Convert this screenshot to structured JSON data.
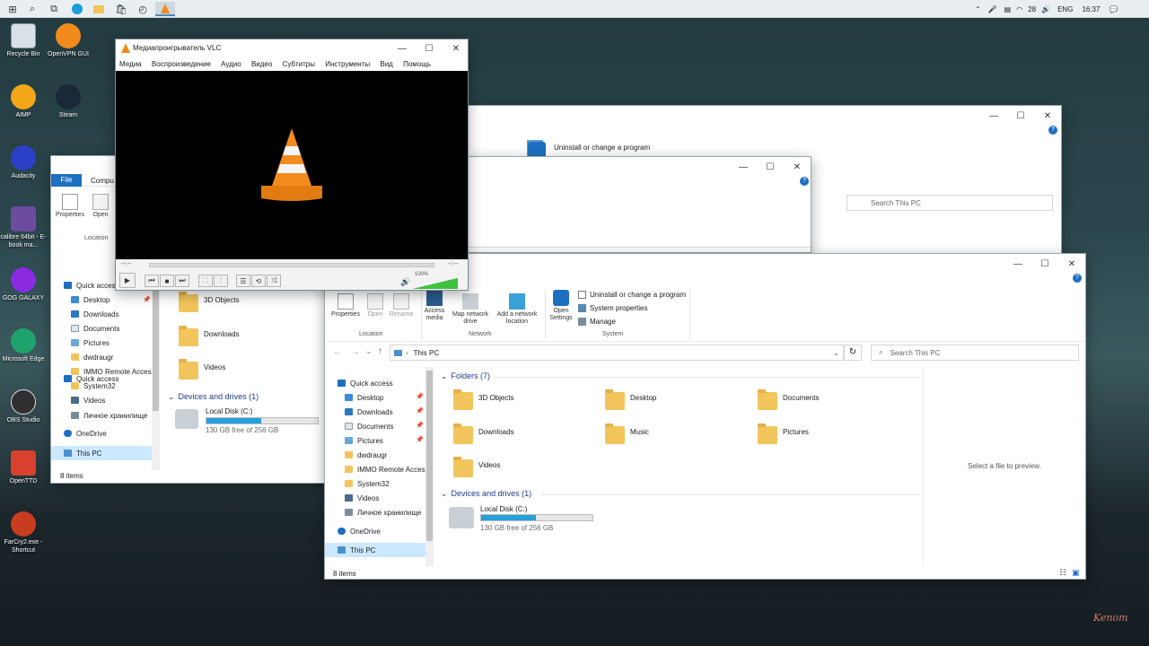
{
  "taskbar": {
    "time": "16:37",
    "lang": "ENG",
    "weather": "28"
  },
  "desktop": {
    "icons": [
      {
        "name": "recycle-bin-icon",
        "label": "Recycle Bin"
      },
      {
        "name": "openvpn-icon",
        "label": "OpenVPN GUI"
      },
      {
        "name": "aimp-icon",
        "label": "AIMP"
      },
      {
        "name": "steam-icon",
        "label": "Steam"
      },
      {
        "name": "audacity-icon",
        "label": "Audacity"
      },
      {
        "name": "calibre-icon",
        "label": "calibre 64bit - E-book ma..."
      },
      {
        "name": "gog-galaxy-icon",
        "label": "GOG GALAXY"
      },
      {
        "name": "microsoft-edge-icon",
        "label": "Microsoft Edge"
      },
      {
        "name": "obs-studio-icon",
        "label": "OBS Studio"
      },
      {
        "name": "openttd-icon",
        "label": "OpenTTD"
      },
      {
        "name": "farcry2-icon",
        "label": "FarCry2.exe - Shortcut"
      }
    ],
    "watermark": "Kenom"
  },
  "vlc": {
    "title": "Медиапроигрыватель VLC",
    "menu": [
      "Медиа",
      "Воспроизведение",
      "Аудио",
      "Видео",
      "Субтитры",
      "Инструменты",
      "Вид",
      "Помощь"
    ],
    "time_left": "--:--",
    "time_right": "--:--",
    "volume": "100%"
  },
  "explorer_bg": {
    "uninstall": "Uninstall or change a program",
    "search_placeholder": "Search This PC"
  },
  "explorer_left": {
    "tab_file": "File",
    "tab_computer": "Compu",
    "properties": "Properties",
    "open": "Open",
    "location": "Location",
    "nav": [
      "Quick access",
      "Desktop",
      "Downloads",
      "Documents",
      "Pictures",
      "dwdraugr",
      "IMMO Remote Acces",
      "System32",
      "Videos",
      "Личное хранилище",
      "OneDrive",
      "This PC"
    ],
    "folders": [
      "3D Objects",
      "Downloads",
      "Videos"
    ],
    "devices_header": "Devices and drives (1)",
    "drive_name": "Local Disk (C:)",
    "drive_free": "130 GB free of 256 GB",
    "drive_fill": 0.49,
    "status": "8 items"
  },
  "explorer_main": {
    "ribbon": {
      "properties": "Properties",
      "open": "Open",
      "rename": "Rename",
      "access_media": "Access media",
      "map_network_drive": "Map network drive",
      "add_network_location": "Add a network location",
      "open_settings": "Open Settings",
      "uninstall": "Uninstall or change a program",
      "system_properties": "System properties",
      "manage": "Manage",
      "group_location": "Location",
      "group_network": "Network",
      "group_system": "System"
    },
    "address": "This PC",
    "search_placeholder": "Search This PC",
    "nav": [
      "Quick access",
      "Desktop",
      "Downloads",
      "Documents",
      "Pictures",
      "dwdraugr",
      "IMMO Remote Acces",
      "System32",
      "Videos",
      "Личное хранилище",
      "OneDrive",
      "This PC"
    ],
    "folders_header": "Folders (7)",
    "folders": [
      "3D Objects",
      "Desktop",
      "Documents",
      "Downloads",
      "Music",
      "Pictures",
      "Videos"
    ],
    "devices_header": "Devices and drives (1)",
    "drive_name": "Local Disk (C:)",
    "drive_free": "130 GB free of 256 GB",
    "drive_fill": 0.49,
    "preview": "Select a file to preview.",
    "status": "8 items"
  }
}
